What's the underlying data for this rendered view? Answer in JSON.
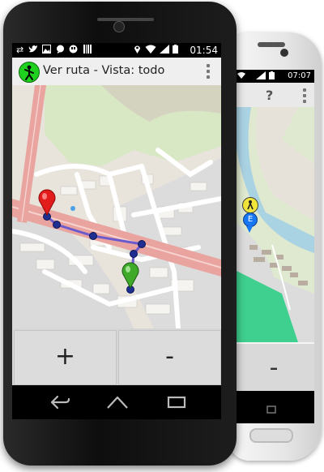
{
  "back_device": {
    "status_time": "07:07",
    "help_label": "?",
    "minus_label": "-",
    "marker_letter": "E"
  },
  "front_device": {
    "status_time": "01:54",
    "title": "Ver ruta - Vista: todo",
    "zoom_in_label": "+",
    "zoom_out_label": "-"
  },
  "colors": {
    "app_icon": "#1fd01f",
    "start_pin": "#e21b1b",
    "end_pin": "#3faa2a",
    "route_waypoint": "#1f2f8f",
    "route_line": "#6a5acd"
  },
  "icons": [
    "wifi-icon",
    "signal-icon",
    "battery-icon",
    "location-icon",
    "back-icon",
    "home-icon",
    "recents-icon"
  ]
}
